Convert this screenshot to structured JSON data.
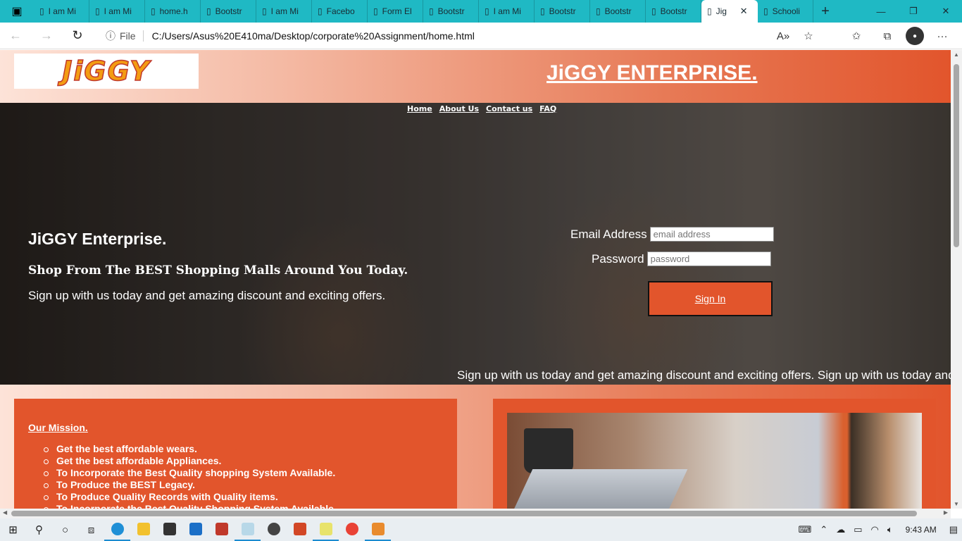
{
  "browser": {
    "tabs": [
      {
        "label": "I am Mi",
        "active": false
      },
      {
        "label": "I am Mi",
        "active": false
      },
      {
        "label": "home.h",
        "active": false
      },
      {
        "label": "Bootstr",
        "active": false
      },
      {
        "label": "I am Mi",
        "active": false
      },
      {
        "label": "Facebo",
        "active": false
      },
      {
        "label": "Form El",
        "active": false
      },
      {
        "label": "Bootstr",
        "active": false
      },
      {
        "label": "I am Mi",
        "active": false
      },
      {
        "label": "Bootstr",
        "active": false
      },
      {
        "label": "Bootstr",
        "active": false
      },
      {
        "label": "Bootstr",
        "active": false
      },
      {
        "label": "Jig",
        "active": true
      },
      {
        "label": "Schooli",
        "active": false
      }
    ],
    "address": {
      "scheme": "File",
      "url": "C:/Users/Asus%20E410ma/Desktop/corporate%20Assignment/home.html"
    }
  },
  "site": {
    "logo_text": "JiGGY",
    "title": "JiGGY ENTERPRISE.",
    "nav": [
      "Home",
      "About Us",
      "Contact us",
      "FAQ"
    ],
    "hero": {
      "title": "JiGGY Enterprise.",
      "subtitle": "Shop From The BEST Shopping Malls Around You Today.",
      "text": "Sign up with us today and get amazing discount and exciting offers.",
      "marquee": "Sign up with us today and get amazing discount and exciting offers. Sign up with us today and get"
    },
    "login": {
      "email_label": "Email Address",
      "email_placeholder": "email address",
      "password_label": "Password",
      "password_placeholder": "password",
      "signin_label": "Sign In"
    },
    "mission": {
      "heading": "Our Mission.",
      "items": [
        "Get the best affordable wears.",
        "Get the best affordable Appliances.",
        "To Incorporate the Best Quality shopping System Available.",
        "To Produce the BEST Legacy.",
        "To Produce Quality Records with Quality items.",
        "To Incorporate the Best Quality Shopping System Available."
      ]
    }
  },
  "taskbar": {
    "time": "9:43 AM"
  },
  "colors": {
    "tab_strip": "#1fb9c4",
    "brand_orange": "#e2552c"
  }
}
